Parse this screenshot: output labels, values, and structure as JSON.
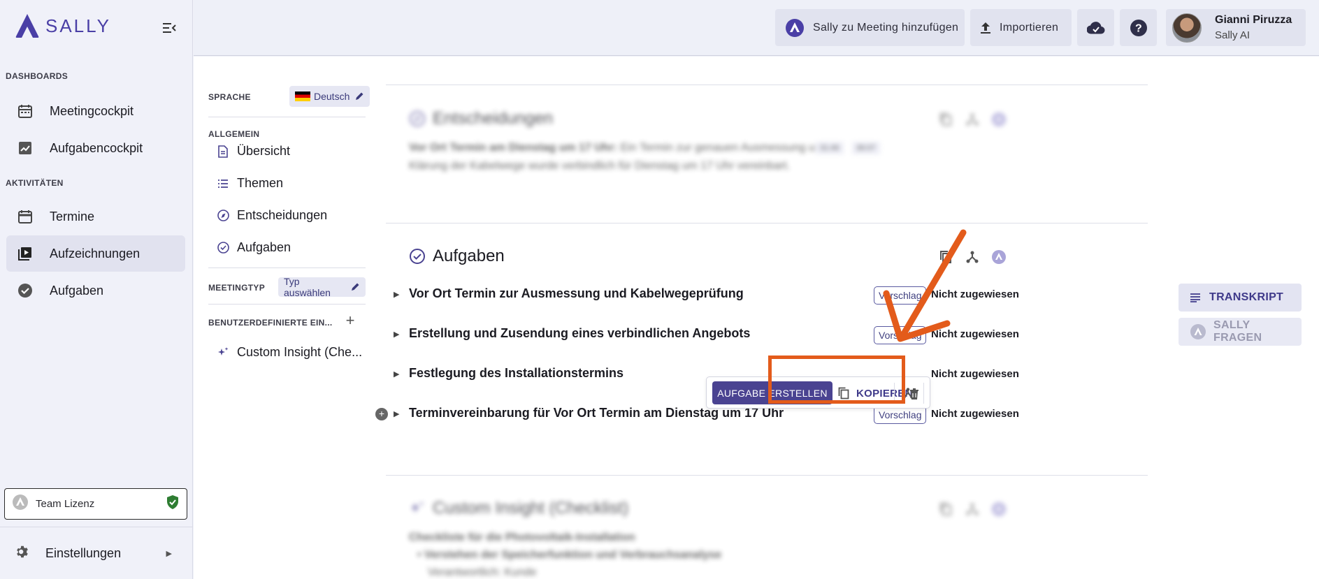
{
  "app": {
    "logo_text": "SALLY"
  },
  "sidebar": {
    "dashboards_label": "DASHBOARDS",
    "activities_label": "AKTIVITÄTEN",
    "items": [
      {
        "label": "Meetingcockpit",
        "icon": "calendar-grid-icon"
      },
      {
        "label": "Aufgabencockpit",
        "icon": "chart-icon"
      },
      {
        "label": "Termine",
        "icon": "calendar-icon"
      },
      {
        "label": "Aufzeichnungen",
        "icon": "video-library-icon",
        "active": true
      },
      {
        "label": "Aufgaben",
        "icon": "check-circle-icon"
      }
    ],
    "license_label": "Team Lizenz",
    "settings_label": "Einstellungen"
  },
  "topbar": {
    "add_to_meeting": "Sally zu Meeting hinzufügen",
    "import": "Importieren",
    "user_name": "Gianni Piruzza",
    "user_org": "Sally AI"
  },
  "toc": {
    "language_label": "SPRACHE",
    "language_value": "Deutsch",
    "general_label": "ALLGEMEIN",
    "items": [
      "Übersicht",
      "Themen",
      "Entscheidungen",
      "Aufgaben"
    ],
    "meeting_type_label": "MEETINGTYP",
    "meeting_type_value": "Typ auswählen",
    "custom_label": "BENUTZERDEFINIERTE EIN...",
    "custom_item": "Custom Insight (Che..."
  },
  "decisions": {
    "title": "Entscheidungen",
    "line1_bold": "Vor Ort Termin am Dienstag um 17 Uhr:",
    "line1_rest": "Ein Termin zur genauen Ausmessung und",
    "line2": "Klärung der Kabelwege wurde verbindlich für Dienstag um 17 Uhr vereinbart.",
    "timestamps": [
      "31:46",
      "36:07"
    ]
  },
  "tasks": {
    "title": "Aufgaben",
    "rows": [
      {
        "title": "Vor Ort Termin zur Ausmessung und Kabelwegeprüfung",
        "badge": "Vorschlag",
        "assignee": "Nicht zugewiesen"
      },
      {
        "title": "Erstellung und Zusendung eines verbindlichen Angebots",
        "badge": "Vorschlag",
        "assignee": "Nicht zugewiesen"
      },
      {
        "title": "Festlegung des Installationstermins",
        "badge": "",
        "assignee": "Nicht zugewiesen"
      },
      {
        "title": "Terminvereinbarung für Vor Ort Termin am Dienstag um 17 Uhr",
        "badge": "Vorschlag",
        "assignee": "Nicht zugewiesen"
      }
    ],
    "toolbar": {
      "create": "AUFGABE ERSTELLEN",
      "copy": "KOPIEREN"
    }
  },
  "custom_insight": {
    "title": "Custom Insight (Checklist)",
    "line1": "Checkliste für die Photovoltaik-Installation",
    "line2": "Verstehen der Speicherfunktion und Verbrauchsanalyse",
    "line3": "Verantwortlich: Kunde"
  },
  "right_panel": {
    "transcript": "TRANSKRIPT",
    "ask_sally": "SALLY FRAGEN"
  },
  "colors": {
    "accent": "#4a4391",
    "annotation": "#e35b1b",
    "license_ok": "#2e7d32"
  }
}
